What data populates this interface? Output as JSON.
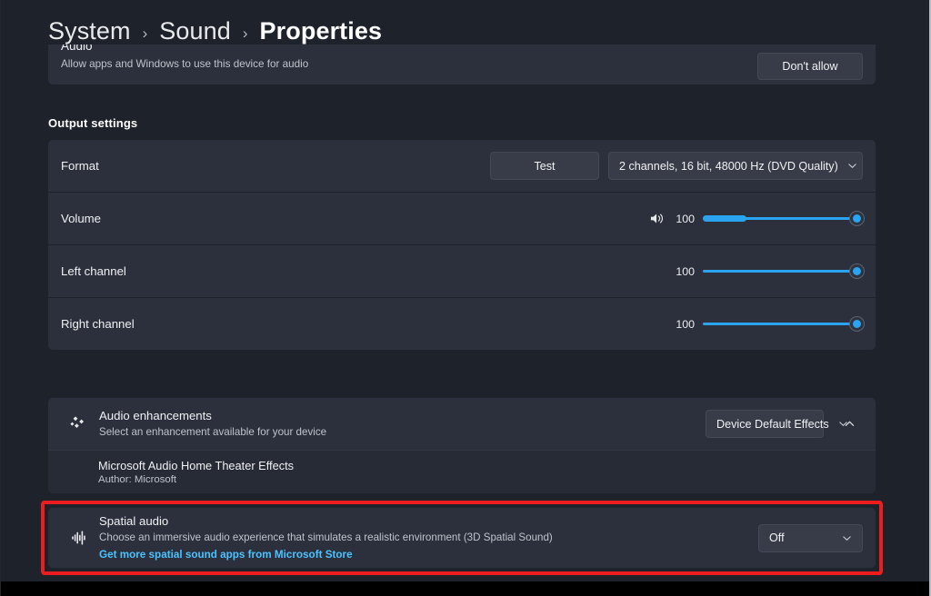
{
  "breadcrumb": {
    "items": [
      "System",
      "Sound",
      "Properties"
    ],
    "separator": "›"
  },
  "audio_card": {
    "title": "Audio",
    "subtitle": "Allow apps and Windows to use this device for audio",
    "button_label": "Don't allow"
  },
  "output_settings": {
    "section_label": "Output settings",
    "format": {
      "label": "Format",
      "test_button": "Test",
      "value": "2 channels, 16 bit, 48000 Hz (DVD Quality)"
    },
    "volume": {
      "label": "Volume",
      "value": "100"
    },
    "left_channel": {
      "label": "Left channel",
      "value": "100"
    },
    "right_channel": {
      "label": "Right channel",
      "value": "100"
    }
  },
  "audio_enhancements": {
    "title": "Audio enhancements",
    "subtitle": "Select an enhancement available for your device",
    "dropdown_value": "Device Default Effects",
    "item": {
      "title": "Microsoft Audio Home Theater Effects",
      "author": "Author: Microsoft"
    }
  },
  "spatial_audio": {
    "title": "Spatial audio",
    "subtitle": "Choose an immersive audio experience that simulates a realistic environment (3D Spatial Sound)",
    "link": "Get more spatial sound apps from Microsoft Store",
    "dropdown_value": "Off"
  },
  "colors": {
    "background": "#1e222b",
    "card": "#2b303c",
    "accent": "#2aa3f0",
    "link": "#4cc2ff",
    "highlight": "#ee1d1d"
  }
}
